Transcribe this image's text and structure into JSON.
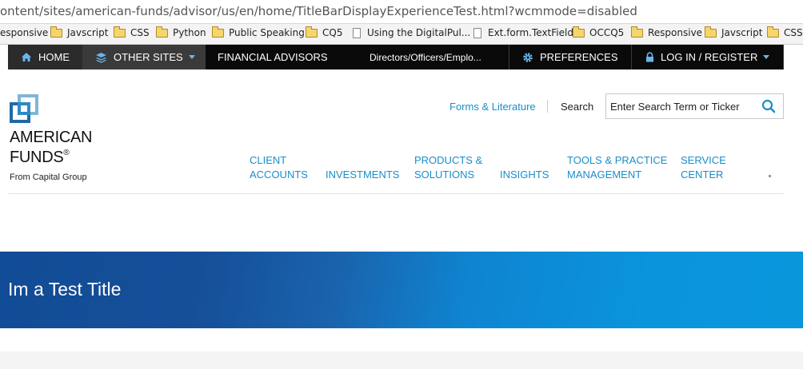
{
  "browser": {
    "url": "ontent/sites/american-funds/advisor/us/en/home/TitleBarDisplayExperienceTest.html?wcmmode=disabled",
    "bookmarks": [
      {
        "label": "esponsive",
        "icon": "none"
      },
      {
        "label": "Javscript",
        "icon": "folder-icon"
      },
      {
        "label": "CSS",
        "icon": "folder-icon"
      },
      {
        "label": "Python",
        "icon": "folder-icon"
      },
      {
        "label": "Public Speaking",
        "icon": "folder-icon"
      },
      {
        "label": "CQ5",
        "icon": "folder-icon"
      },
      {
        "label": "Using the DigitalPul...",
        "icon": "page-icon"
      },
      {
        "label": "Ext.form.TextField",
        "icon": "page-icon"
      },
      {
        "label": "OCCQ5",
        "icon": "folder-icon"
      },
      {
        "label": "Responsive",
        "icon": "folder-icon"
      },
      {
        "label": "Javscript",
        "icon": "folder-icon"
      },
      {
        "label": "CSS",
        "icon": "folder-icon"
      }
    ]
  },
  "topnav": {
    "home": "HOME",
    "other_sites": "OTHER SITES",
    "financial_advisors": "FINANCIAL ADVISORS",
    "directors": "Directors/Officers/Emplo...",
    "preferences": "PREFERENCES",
    "login": "LOG IN / REGISTER"
  },
  "logo": {
    "line1": "AMERICAN",
    "line2": "FUNDS",
    "reg": "®",
    "sub": "From Capital Group"
  },
  "utility": {
    "forms": "Forms & Literature",
    "search_label": "Search",
    "search_placeholder": "Enter Search Term or Ticker"
  },
  "main_nav": {
    "client_l1": "CLIENT",
    "client_l2": "ACCOUNTS",
    "investments": "INVESTMENTS",
    "products_l1": "PRODUCTS &",
    "products_l2": "SOLUTIONS",
    "insights": "INSIGHTS",
    "tools_l1": "TOOLS & PRACTICE",
    "tools_l2": "MANAGEMENT",
    "service_l1": "SERVICE",
    "service_l2": "CENTER"
  },
  "banner": {
    "title": "Im a Test Title"
  },
  "colors": {
    "link_blue": "#1a8ec8",
    "nav_black": "#0a0a0a",
    "banner_dark": "#114c96",
    "banner_light": "#0996db"
  }
}
